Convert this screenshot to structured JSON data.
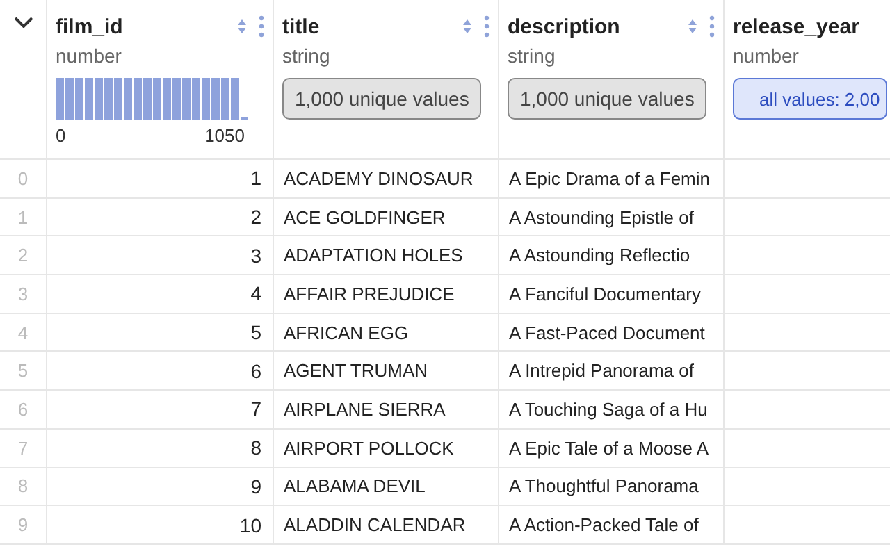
{
  "columns": [
    {
      "name": "film_id",
      "type": "number",
      "controls": true,
      "summary": {
        "kind": "histogram",
        "min_label": "0",
        "max_label": "1050"
      }
    },
    {
      "name": "title",
      "type": "string",
      "controls": true,
      "summary": {
        "kind": "unique",
        "text": "1,000 unique values"
      }
    },
    {
      "name": "description",
      "type": "string",
      "controls": true,
      "summary": {
        "kind": "unique",
        "text": "1,000 unique values"
      }
    },
    {
      "name": "release_year",
      "type": "number",
      "controls": false,
      "summary": {
        "kind": "all_values",
        "text": "all values: 2,00"
      }
    }
  ],
  "rows": [
    {
      "index": "0",
      "film_id": "1",
      "title": "ACADEMY DINOSAUR",
      "description": "A Epic Drama of a Femin"
    },
    {
      "index": "1",
      "film_id": "2",
      "title": "ACE GOLDFINGER",
      "description": "A Astounding Epistle of"
    },
    {
      "index": "2",
      "film_id": "3",
      "title": "ADAPTATION HOLES",
      "description": "A Astounding Reflectio"
    },
    {
      "index": "3",
      "film_id": "4",
      "title": "AFFAIR PREJUDICE",
      "description": "A Fanciful Documentary"
    },
    {
      "index": "4",
      "film_id": "5",
      "title": "AFRICAN EGG",
      "description": "A Fast-Paced Document"
    },
    {
      "index": "5",
      "film_id": "6",
      "title": "AGENT TRUMAN",
      "description": "A Intrepid Panorama of"
    },
    {
      "index": "6",
      "film_id": "7",
      "title": "AIRPLANE SIERRA",
      "description": "A Touching Saga of a Hu"
    },
    {
      "index": "7",
      "film_id": "8",
      "title": "AIRPORT POLLOCK",
      "description": "A Epic Tale of a Moose A"
    },
    {
      "index": "8",
      "film_id": "9",
      "title": "ALABAMA DEVIL",
      "description": "A Thoughtful Panorama"
    },
    {
      "index": "9",
      "film_id": "10",
      "title": "ALADDIN CALENDAR",
      "description": "A Action-Packed Tale of"
    }
  ]
}
